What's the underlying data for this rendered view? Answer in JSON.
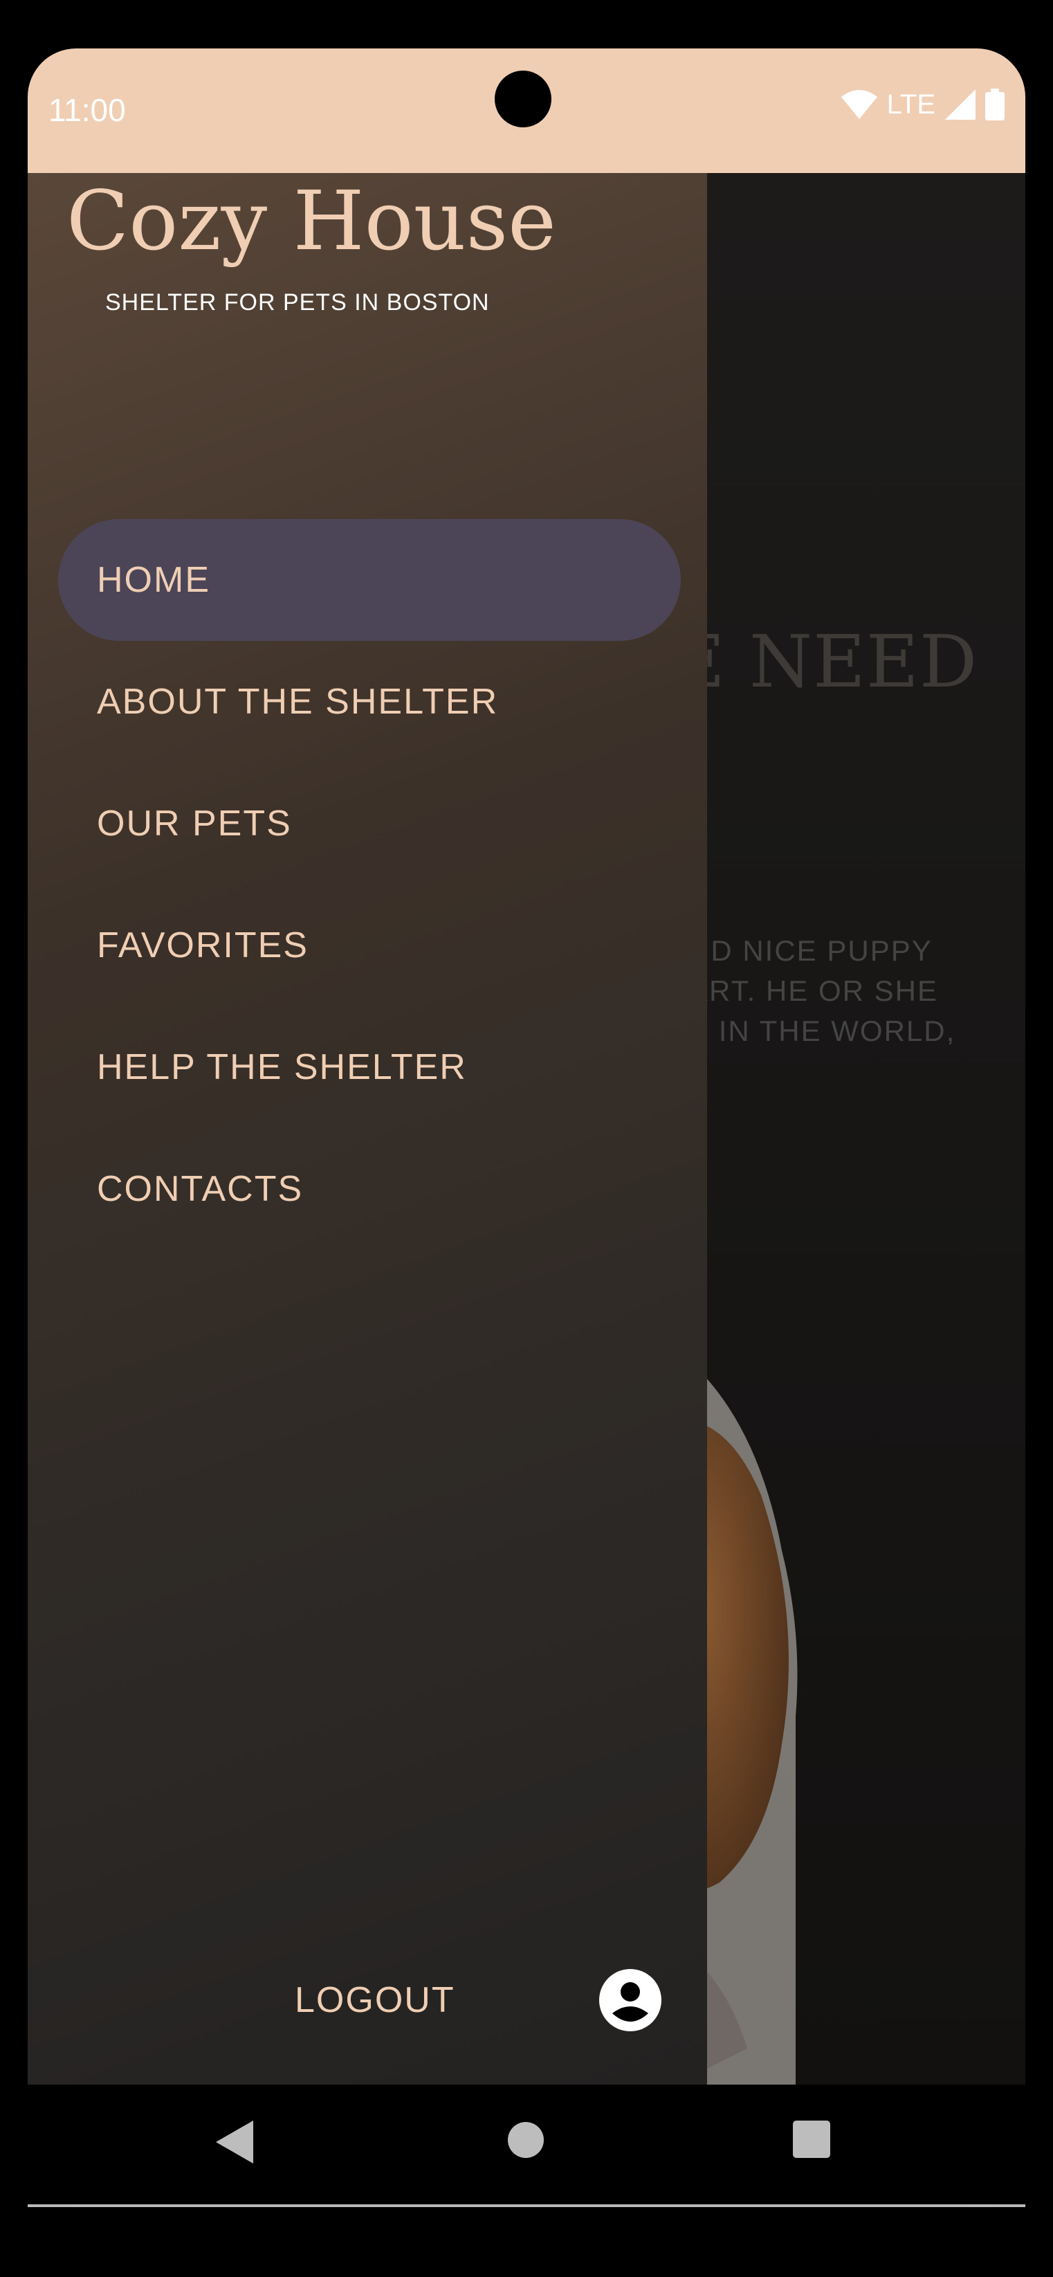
{
  "status_bar": {
    "time": "11:00",
    "network": "LTE",
    "icons": [
      "wifi-icon",
      "signal-icon",
      "battery-icon"
    ],
    "background": "#f0ceb4"
  },
  "background_page": {
    "hero_title": "E NEED",
    "hero_lines": [
      "AND NICE PUPPY",
      "EART. HE OR SHE",
      "SE IN THE WORLD,"
    ]
  },
  "drawer": {
    "title": "Cozy House",
    "subtitle": "SHELTER FOR PETS IN BOSTON",
    "items": [
      {
        "label": "HOME",
        "active": true
      },
      {
        "label": "ABOUT THE SHELTER",
        "active": false
      },
      {
        "label": "OUR PETS",
        "active": false
      },
      {
        "label": "FAVORITES",
        "active": false
      },
      {
        "label": "HELP THE SHELTER",
        "active": false
      },
      {
        "label": "CONTACTS",
        "active": false
      }
    ],
    "logout_label": "LOGOUT",
    "account_icon": "account-circle-icon",
    "accent": "#f0ceb4",
    "active_bg": "#4b4557"
  },
  "nav_bar": {
    "icons": [
      "back-icon",
      "home-icon",
      "recents-icon"
    ]
  }
}
